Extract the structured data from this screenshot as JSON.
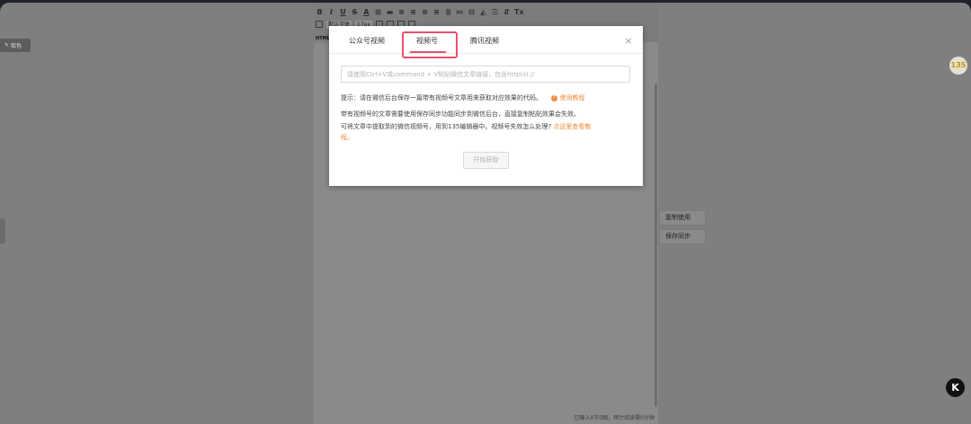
{
  "toolbar": {
    "row1": [
      "B",
      "I",
      "U",
      "S",
      "A",
      "⊞",
      "▬",
      "≡",
      "≡",
      "≡",
      "≡",
      "≣",
      "≔",
      "⊟",
      "◭",
      "☰",
      "⇵",
      "Tx"
    ],
    "font_select": "默认字体",
    "size_select": "17px",
    "html_label": "HTML"
  },
  "left": {
    "color_tag": "取色"
  },
  "modal": {
    "tabs": [
      "公众号视频",
      "视频号",
      "腾讯视频"
    ],
    "active_tab": "视频号",
    "close_icon": "×",
    "input_placeholder": "请使用Ctrl+V或command + V粘贴微信文章链接，包含http(s)://",
    "tip_text": "提示：请在微信后台保存一篇带有视频号文章用来获取对应效果的代码。",
    "tip_link": "使用教程",
    "note1": "带有视频号的文章需要使用保存同步功能同步到微信后台，直接复制粘贴效果会失效。",
    "note2_prefix": "可将文章中提取到的微信视频号，用到135编辑器中。视频号失效怎么处理?",
    "note2_link_part1": "点这里查看教",
    "note2_link_part2": "程。",
    "start_button": "开始获取"
  },
  "side_buttons": {
    "copy": "复制使用",
    "save_sync": "保存同步"
  },
  "status_bar": "已输入0字0图，预计阅读需0分钟",
  "logos": {
    "right_badge": "135",
    "bottom_badge": "K"
  },
  "colors": {
    "accent_red": "#e9506a",
    "link_orange": "#f08a3a",
    "overlay_gray": "#7f7f7f"
  }
}
